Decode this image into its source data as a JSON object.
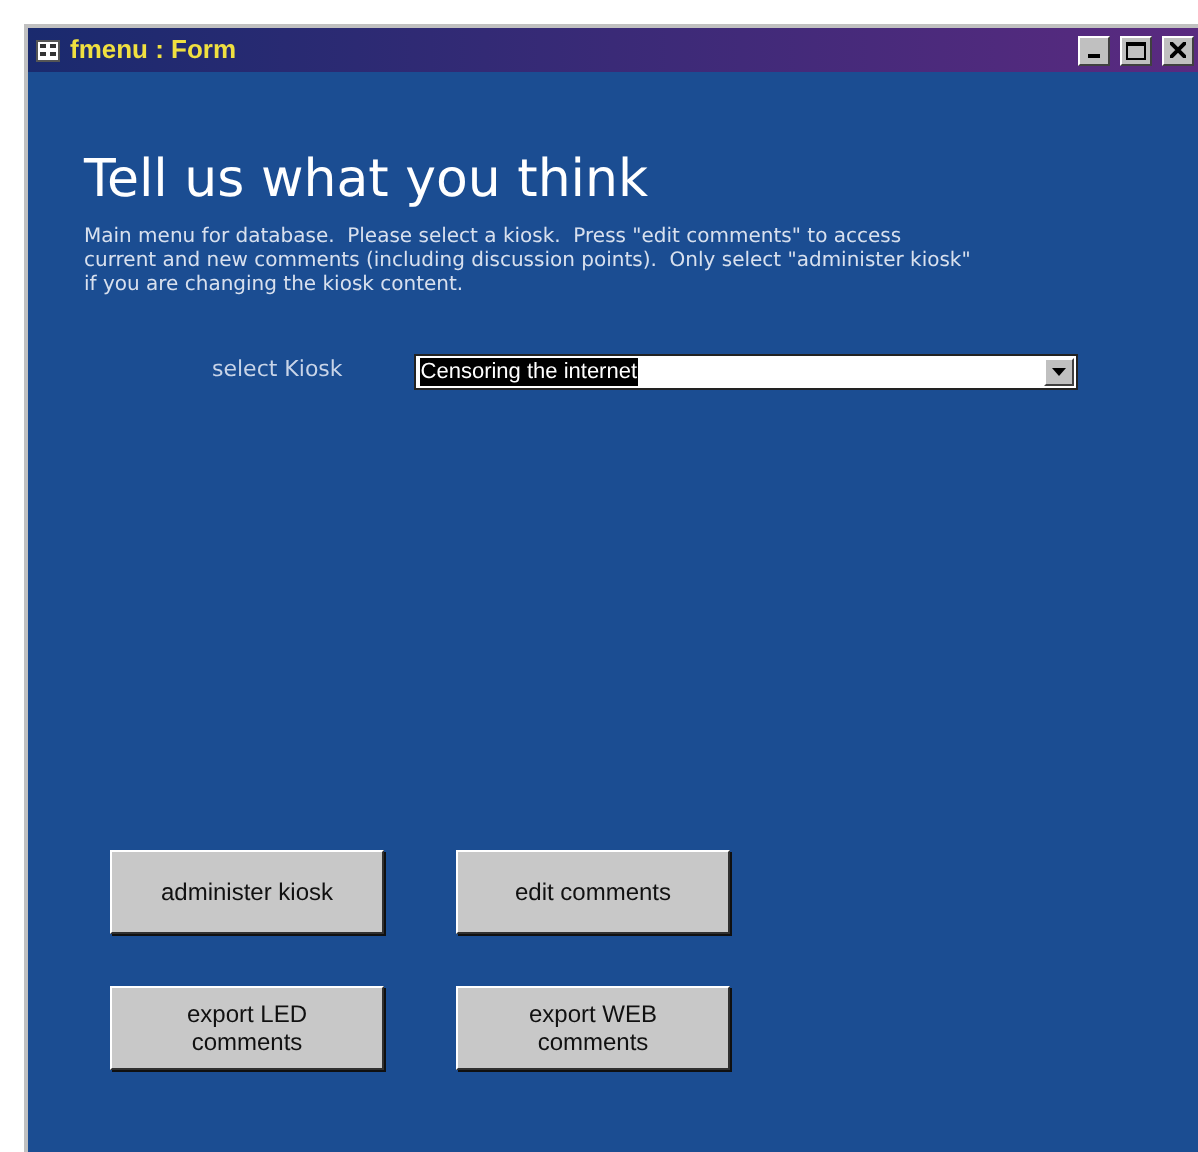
{
  "window": {
    "title": "fmenu : Form"
  },
  "heading": "Tell us what you think",
  "description": "Main menu for database.  Please select a kiosk.  Press \"edit comments\" to access current and new comments (including discussion points).  Only select \"administer kiosk\" if you are changing the kiosk content.",
  "kiosk_select": {
    "label": "select Kiosk",
    "value": "Censoring the internet",
    "text_selected": true
  },
  "buttons": [
    {
      "label": "administer kiosk"
    },
    {
      "label": "edit comments"
    },
    {
      "label": "export LED comments"
    },
    {
      "label": "export WEB comments"
    }
  ]
}
